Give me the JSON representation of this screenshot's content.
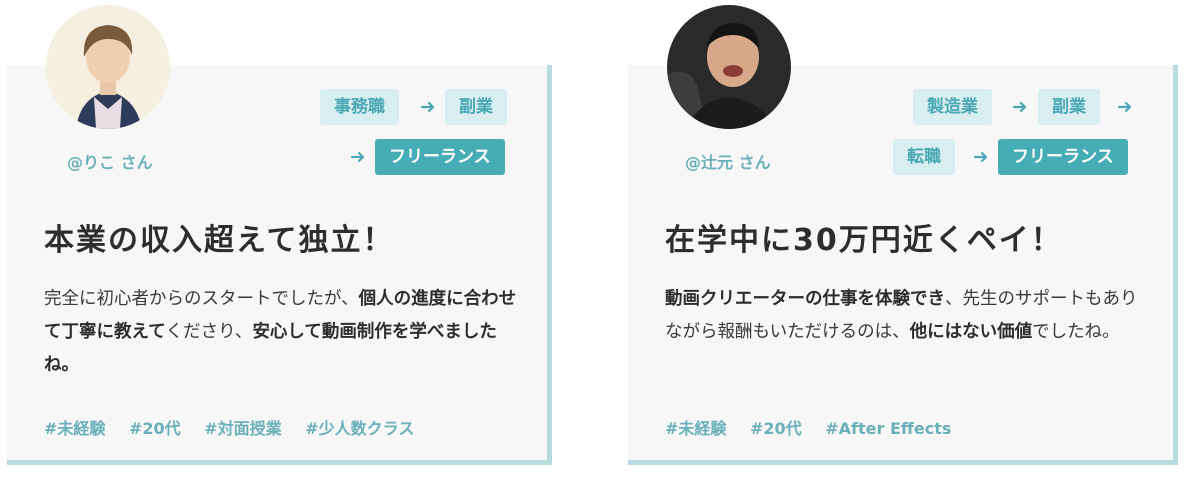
{
  "cards": [
    {
      "user": "@りこ さん",
      "path": [
        "事務職",
        "副業",
        "フリーランス"
      ],
      "title": "本業の収入超えて独立！",
      "body": [
        {
          "text": "完全に初心者からのスタートでしたが、",
          "bold": false
        },
        {
          "text": "個人の進度に合わせて丁寧に教えて",
          "bold": true
        },
        {
          "text": "くださり、",
          "bold": false
        },
        {
          "text": "安心して動画制作を学べましたね。",
          "bold": true
        }
      ],
      "tags": [
        "#未経験",
        "#20代",
        "#対面授業",
        "#少人数クラス"
      ]
    },
    {
      "user": "@辻元 さん",
      "path": [
        "製造業",
        "副業",
        "転職",
        "フリーランス"
      ],
      "title": "在学中に30万円近くペイ！",
      "body": [
        {
          "text": "動画クリエーターの仕事を体験でき",
          "bold": true
        },
        {
          "text": "、先生のサポートもありながら報酬もいただけるのは、",
          "bold": false
        },
        {
          "text": "他にはない価値",
          "bold": true
        },
        {
          "text": "でしたね。",
          "bold": false
        }
      ],
      "tags": [
        "#未経験",
        "#20代",
        "#After Effects"
      ]
    }
  ],
  "icons": {
    "arrow": "arrow-right-icon"
  },
  "colors": {
    "accent": "#46adb6",
    "accent_light": "#d9eef1",
    "tag_text": "#6ab0bb",
    "card_shadow": "#b8dbe0",
    "card_bg": "#f7f7f7"
  }
}
